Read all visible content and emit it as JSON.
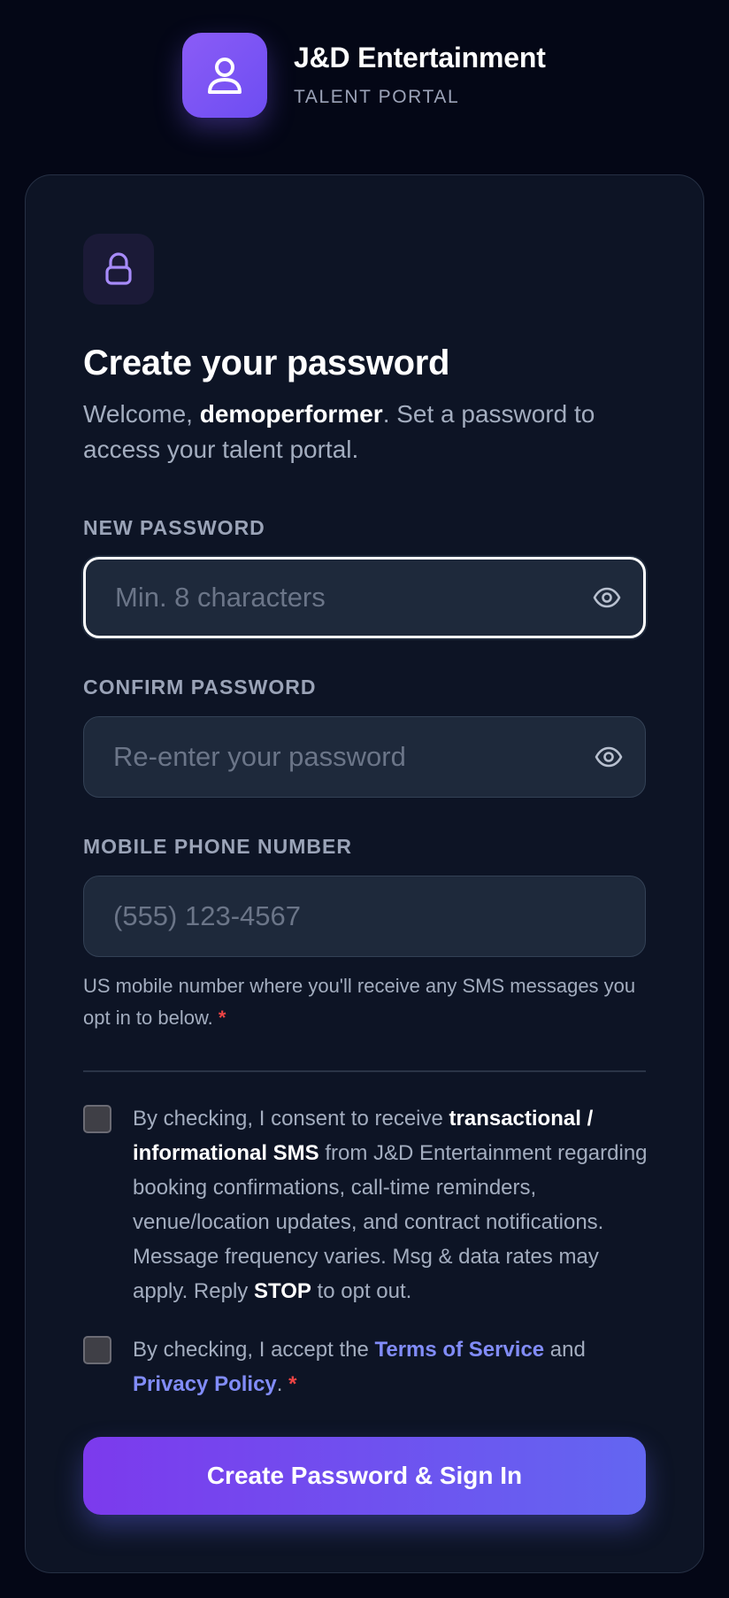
{
  "brand": {
    "name": "J&D Entertainment",
    "subtitle": "TALENT PORTAL",
    "logo_icon": "user-icon",
    "accent_color": "#8b5cf6"
  },
  "card": {
    "icon": "lock-icon",
    "title": "Create your password",
    "welcome_prefix": "Welcome, ",
    "username": "demoperformer",
    "welcome_suffix": ". Set a password to access your talent portal."
  },
  "fields": {
    "new_password": {
      "label": "NEW PASSWORD",
      "placeholder": "Min. 8 characters",
      "value": "",
      "toggle_icon": "eye-icon"
    },
    "confirm_password": {
      "label": "CONFIRM PASSWORD",
      "placeholder": "Re-enter your password",
      "value": "",
      "toggle_icon": "eye-icon"
    },
    "phone": {
      "label": "MOBILE PHONE NUMBER",
      "placeholder": "(555) 123-4567",
      "value": "",
      "helper": "US mobile number where you'll receive any SMS messages you opt in to below.",
      "required_mark": "*"
    }
  },
  "consents": {
    "sms": {
      "checked": false,
      "text_1": "By checking, I consent to receive ",
      "bold_1": "transactional / informational SMS",
      "text_2": " from J&D Entertainment regarding booking confirmations, call-time reminders, venue/location updates, and contract notifications. Message frequency varies. Msg & data rates may apply. Reply ",
      "bold_2": "STOP",
      "text_3": " to opt out."
    },
    "terms": {
      "checked": false,
      "text_1": "By checking, I accept the ",
      "terms_link": "Terms of Service",
      "text_2": " and ",
      "privacy_link": "Privacy Policy",
      "text_3": ". ",
      "required_mark": "*"
    }
  },
  "submit": {
    "label": "Create Password & Sign In"
  },
  "colors": {
    "background": "#040716",
    "card": "#0d1425",
    "input": "#1e293b",
    "link": "#818cf8",
    "required": "#ef4444",
    "button_start": "#7c3aed",
    "button_end": "#6366f1"
  }
}
